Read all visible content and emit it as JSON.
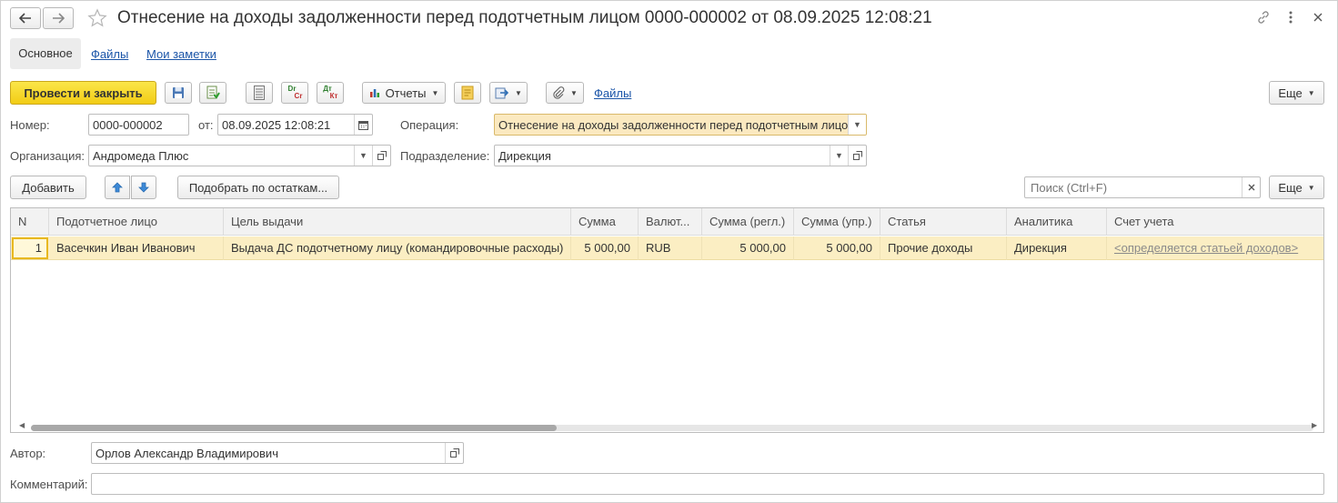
{
  "window": {
    "title": "Отнесение на доходы задолженности перед подотчетным лицом 0000-000002 от 08.09.2025 12:08:21"
  },
  "tabs": [
    {
      "label": "Основное"
    },
    {
      "label": "Файлы"
    },
    {
      "label": "Мои заметки"
    }
  ],
  "toolbar": {
    "post_close": "Провести и закрыть",
    "reports": "Отчеты",
    "files_link": "Файлы",
    "more": "Еще",
    "dr_cr_top": "Dr",
    "dr_cr_bottom": "Cr",
    "dt_kt_top": "Дт",
    "dt_kt_bottom": "Кт"
  },
  "form": {
    "number_label": "Номер:",
    "number_value": "0000-000002",
    "date_label": "от:",
    "date_value": "08.09.2025 12:08:21",
    "operation_label": "Операция:",
    "operation_value": "Отнесение на доходы задолженности перед подотчетным лицом",
    "org_label": "Организация:",
    "org_value": "Андромеда Плюс",
    "dept_label": "Подразделение:",
    "dept_value": "Дирекция"
  },
  "table_toolbar": {
    "add": "Добавить",
    "pick_by_balance": "Подобрать по остаткам...",
    "search_placeholder": "Поиск (Ctrl+F)",
    "more": "Еще"
  },
  "table": {
    "columns": [
      "N",
      "Подотчетное лицо",
      "Цель выдачи",
      "Сумма",
      "Валют...",
      "Сумма (регл.)",
      "Сумма (упр.)",
      "Статья",
      "Аналитика",
      "Счет учета"
    ],
    "rows": [
      {
        "n": "1",
        "person": "Васечкин Иван Иванович",
        "purpose": "Выдача ДС подотчетному лицу (командировочные расходы)",
        "amount": "5 000,00",
        "currency": "RUB",
        "amount_reg": "5 000,00",
        "amount_mgmt": "5 000,00",
        "item": "Прочие доходы",
        "analytics": "Дирекция",
        "account": "<определяется статьей доходов>"
      }
    ]
  },
  "footer": {
    "author_label": "Автор:",
    "author_value": "Орлов Александр Владимирович",
    "comment_label": "Комментарий:",
    "comment_value": ""
  },
  "colors": {
    "primary_button": "#f2cc15",
    "selected_row": "#fbeec3",
    "operation_field": "#fbe9c0",
    "link": "#1b55a8"
  }
}
